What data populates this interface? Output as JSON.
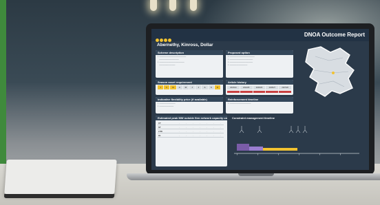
{
  "report": {
    "title": "DNOA Outcome Report",
    "subtitle": "Abernethy, Kinross, Dollar",
    "panels": {
      "scheme_description": "Scheme description",
      "proposed_option": "Proposed option",
      "season_requirement": "Season asset requirement",
      "indicative_price": "Indicative flexibility price (if available)",
      "article_history": "Article history",
      "reinforcement_timeline": "Reinforcement timeline",
      "estimated_table": "Estimated peak MW outside firm network capacity under each scenario",
      "constraint_timeline": "Constraint management timeline"
    },
    "months": [
      "J",
      "F",
      "M",
      "A",
      "M",
      "J",
      "J",
      "A",
      "S",
      "O",
      "N",
      "D"
    ],
    "years": [
      "2023/24",
      "2024/25",
      "2025/26",
      "2026/27",
      "2027/28"
    ],
    "table_rows": [
      "CT",
      "ST",
      "LTW",
      "HL"
    ],
    "colors": {
      "accent": "#f2c230",
      "header": "#223244",
      "panel_header": "#34475a",
      "bar": "#c94141"
    }
  }
}
